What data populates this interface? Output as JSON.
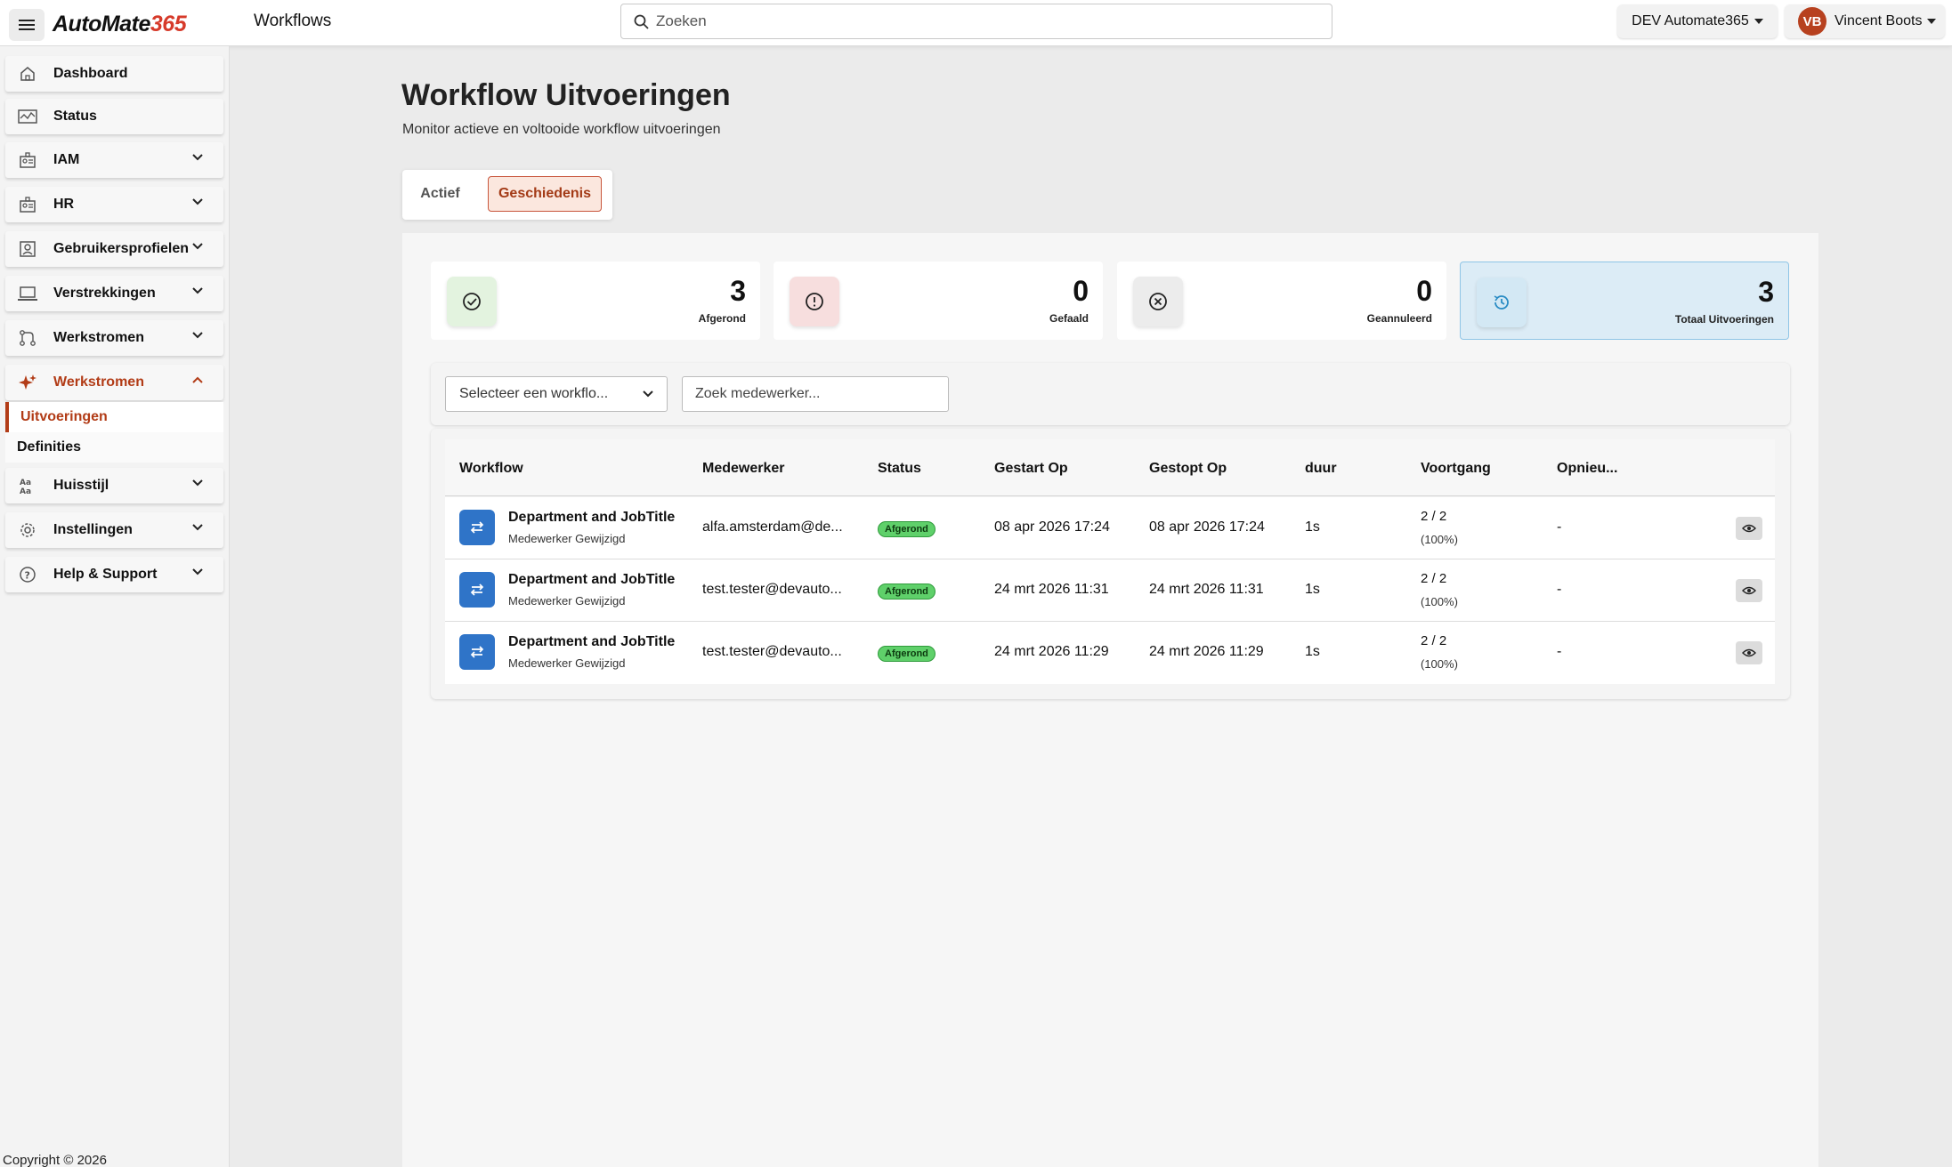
{
  "topbar": {
    "logo_a": "Auto",
    "logo_b": "Mate",
    "logo_c": "365",
    "page": "Workflows",
    "search_placeholder": "Zoeken",
    "env": "DEV Automate365",
    "user_initials": "VB",
    "user_name": "Vincent Boots"
  },
  "sidebar": {
    "items": [
      {
        "label": "Dashboard",
        "icon": "home-icon"
      },
      {
        "label": "Status",
        "icon": "status-icon"
      },
      {
        "label": "IAM",
        "icon": "iam-icon"
      },
      {
        "label": "HR",
        "icon": "hr-icon"
      },
      {
        "label": "Gebruikersprofielen",
        "icon": "profile-icon"
      },
      {
        "label": "Verstrekkingen",
        "icon": "laptop-icon"
      },
      {
        "label": "Werkstromen",
        "icon": "flow-icon"
      },
      {
        "label": "Werkstromen",
        "icon": "sparkle-icon"
      },
      {
        "label": "Huisstijl",
        "icon": "brand-icon"
      },
      {
        "label": "Instellingen",
        "icon": "gear-icon"
      },
      {
        "label": "Help & Support",
        "icon": "help-icon"
      }
    ],
    "sub": [
      "Uitvoeringen",
      "Definities"
    ],
    "copyright": "Copyright © 2026"
  },
  "main": {
    "title": "Workflow Uitvoeringen",
    "subtitle": "Monitor actieve en voltooide workflow uitvoeringen",
    "tabs": [
      "Actief",
      "Geschiedenis"
    ]
  },
  "stats": [
    {
      "value": "3",
      "label": "Afgerond",
      "color": "#e3f3df"
    },
    {
      "value": "0",
      "label": "Gefaald",
      "color": "#f7dede"
    },
    {
      "value": "0",
      "label": "Geannuleerd",
      "color": "#ececec"
    },
    {
      "value": "3",
      "label": "Totaal Uitvoeringen",
      "color": "#d3e8f4"
    }
  ],
  "filters": {
    "workflow_select": "Selecteer een workflo...",
    "employee_placeholder": "Zoek medewerker..."
  },
  "table": {
    "headers": [
      "Workflow",
      "Medewerker",
      "Status",
      "Gestart Op",
      "Gestopt Op",
      "duur",
      "Voortgang",
      "Opnieu..."
    ],
    "rows": [
      {
        "name": "Department and JobTitle",
        "sub": "Medewerker Gewijzigd",
        "employee": "alfa.amsterdam@de...",
        "status": "Afgerond",
        "started": "08 apr 2026 17:24",
        "stopped": "08 apr 2026 17:24",
        "duration": "1s",
        "progress": "2 / 2",
        "pct": "(100%)",
        "retry": "-"
      },
      {
        "name": "Department and JobTitle",
        "sub": "Medewerker Gewijzigd",
        "employee": "test.tester@devauto...",
        "status": "Afgerond",
        "started": "24 mrt 2026 11:31",
        "stopped": "24 mrt 2026 11:31",
        "duration": "1s",
        "progress": "2 / 2",
        "pct": "(100%)",
        "retry": "-"
      },
      {
        "name": "Department and JobTitle",
        "sub": "Medewerker Gewijzigd",
        "employee": "test.tester@devauto...",
        "status": "Afgerond",
        "started": "24 mrt 2026 11:29",
        "stopped": "24 mrt 2026 11:29",
        "duration": "1s",
        "progress": "2 / 2",
        "pct": "(100%)",
        "retry": "-"
      }
    ]
  },
  "colors": {
    "accent": "#b23c17",
    "success": "#5fd06a",
    "primary": "#2f74c8"
  }
}
